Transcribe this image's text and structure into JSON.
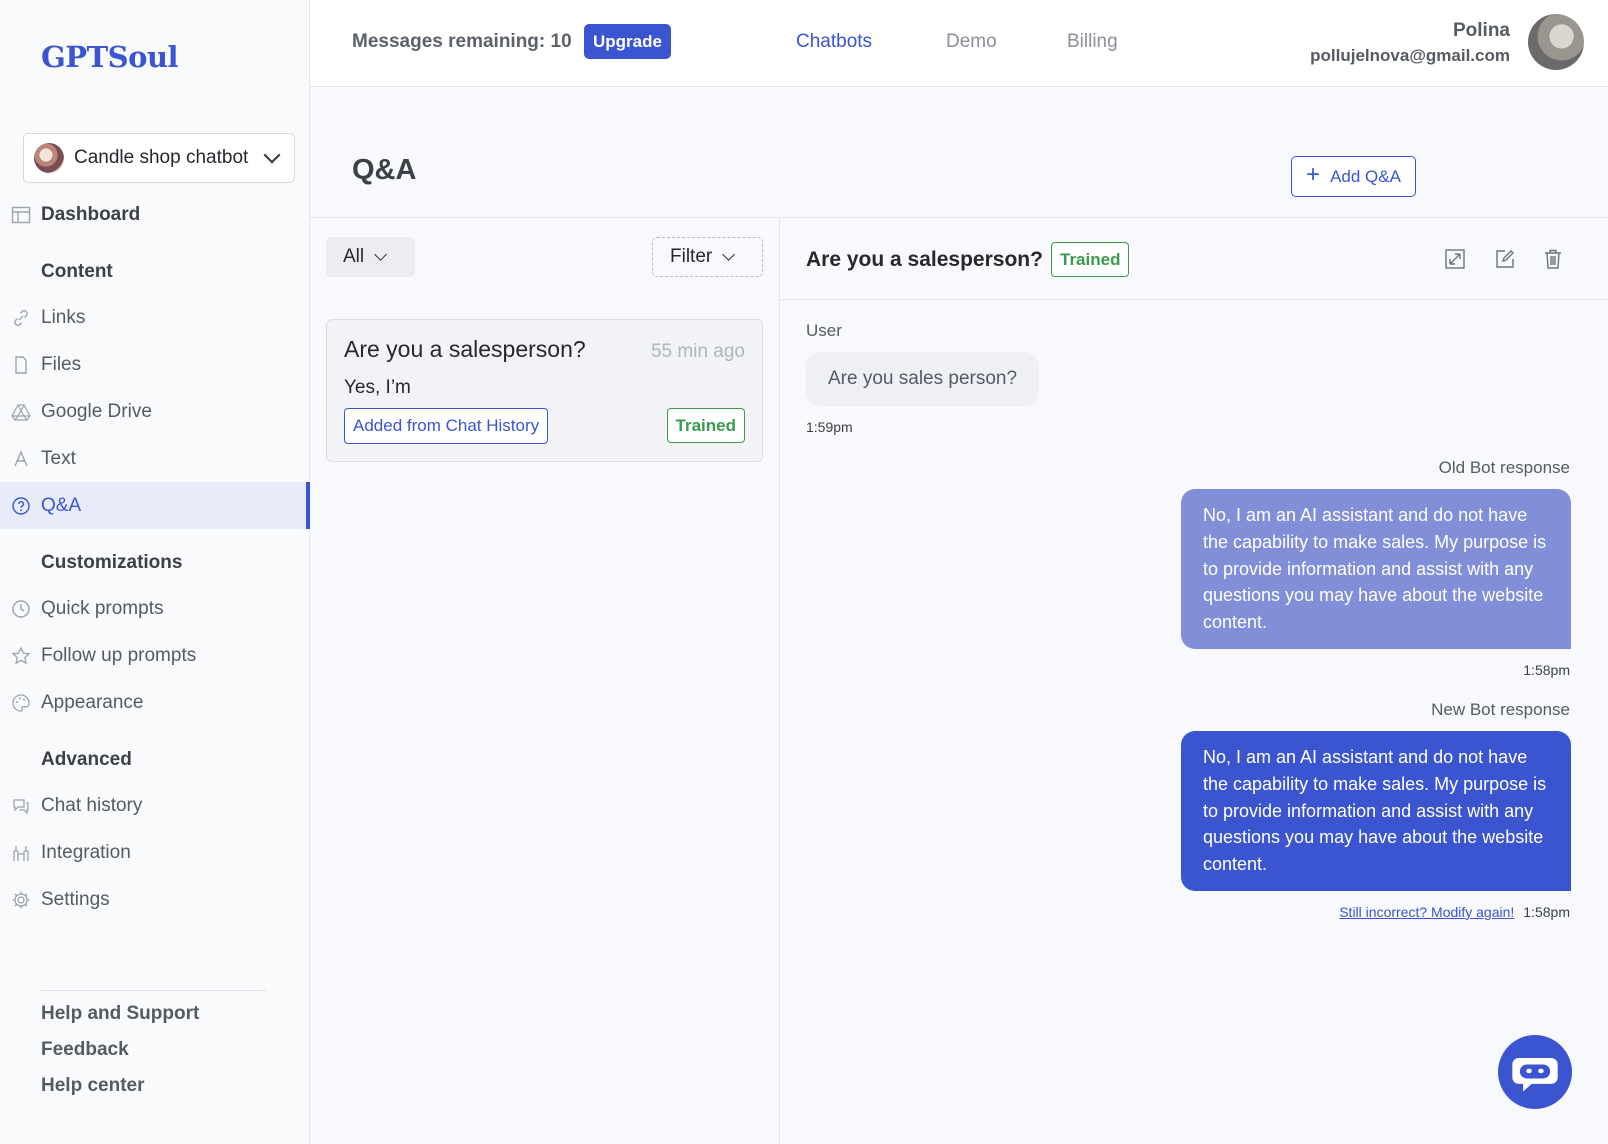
{
  "app": {
    "logo": "GPTSoul"
  },
  "bot_selector": {
    "name": "Candle shop chatbot"
  },
  "sidebar": {
    "dashboard": "Dashboard",
    "sections": {
      "content": "Content",
      "customizations": "Customizations",
      "advanced": "Advanced"
    },
    "content_items": [
      {
        "label": "Links",
        "icon": "link-icon"
      },
      {
        "label": "Files",
        "icon": "file-icon"
      },
      {
        "label": "Google Drive",
        "icon": "google-drive-icon"
      },
      {
        "label": "Text",
        "icon": "text-icon"
      },
      {
        "label": "Q&A",
        "icon": "question-icon",
        "active": true
      }
    ],
    "customization_items": [
      {
        "label": "Quick prompts",
        "icon": "clock-icon"
      },
      {
        "label": "Follow up prompts",
        "icon": "star-icon"
      },
      {
        "label": "Appearance",
        "icon": "palette-icon"
      }
    ],
    "advanced_items": [
      {
        "label": "Chat history",
        "icon": "chat-icon"
      },
      {
        "label": "Integration",
        "icon": "integration-icon"
      },
      {
        "label": "Settings",
        "icon": "gear-icon"
      }
    ],
    "footer": [
      "Help and Support",
      "Feedback",
      "Help center"
    ]
  },
  "topbar": {
    "messages_remaining": "Messages remaining: 10",
    "upgrade": "Upgrade",
    "tabs": [
      "Chatbots",
      "Demo",
      "Billing"
    ],
    "active_tab": "Chatbots",
    "user_name": "Polina",
    "user_email": "pollujelnova@gmail.com"
  },
  "page": {
    "title": "Q&A",
    "add_button": "Add Q&A"
  },
  "list": {
    "all_label": "All",
    "filter_label": "Filter",
    "items": [
      {
        "question": "Are you a salesperson?",
        "time": "55 min ago",
        "answer": "Yes, I’m",
        "source": "Added from Chat History",
        "status": "Trained"
      }
    ]
  },
  "detail": {
    "title": "Are you a salesperson?",
    "status": "Trained",
    "user_label": "User",
    "user_message": "Are you sales person?",
    "user_time": "1:59pm",
    "old_label": "Old Bot response",
    "old_response": "No, I am an AI assistant and do not have the capability to make sales. My purpose is to provide information and assist with any questions you may have about the website content.",
    "old_time": "1:58pm",
    "new_label": "New Bot response",
    "new_response": "No, I am an AI assistant and do not have the capability to make sales. My purpose is to provide information and assist with any questions you may have about the website content.",
    "modify_link": "Still incorrect? Modify again!",
    "new_time": "1:58pm"
  },
  "colors": {
    "accent": "#3b55d1",
    "old_bubble": "#818fd9",
    "trained": "#3a9a4f"
  }
}
